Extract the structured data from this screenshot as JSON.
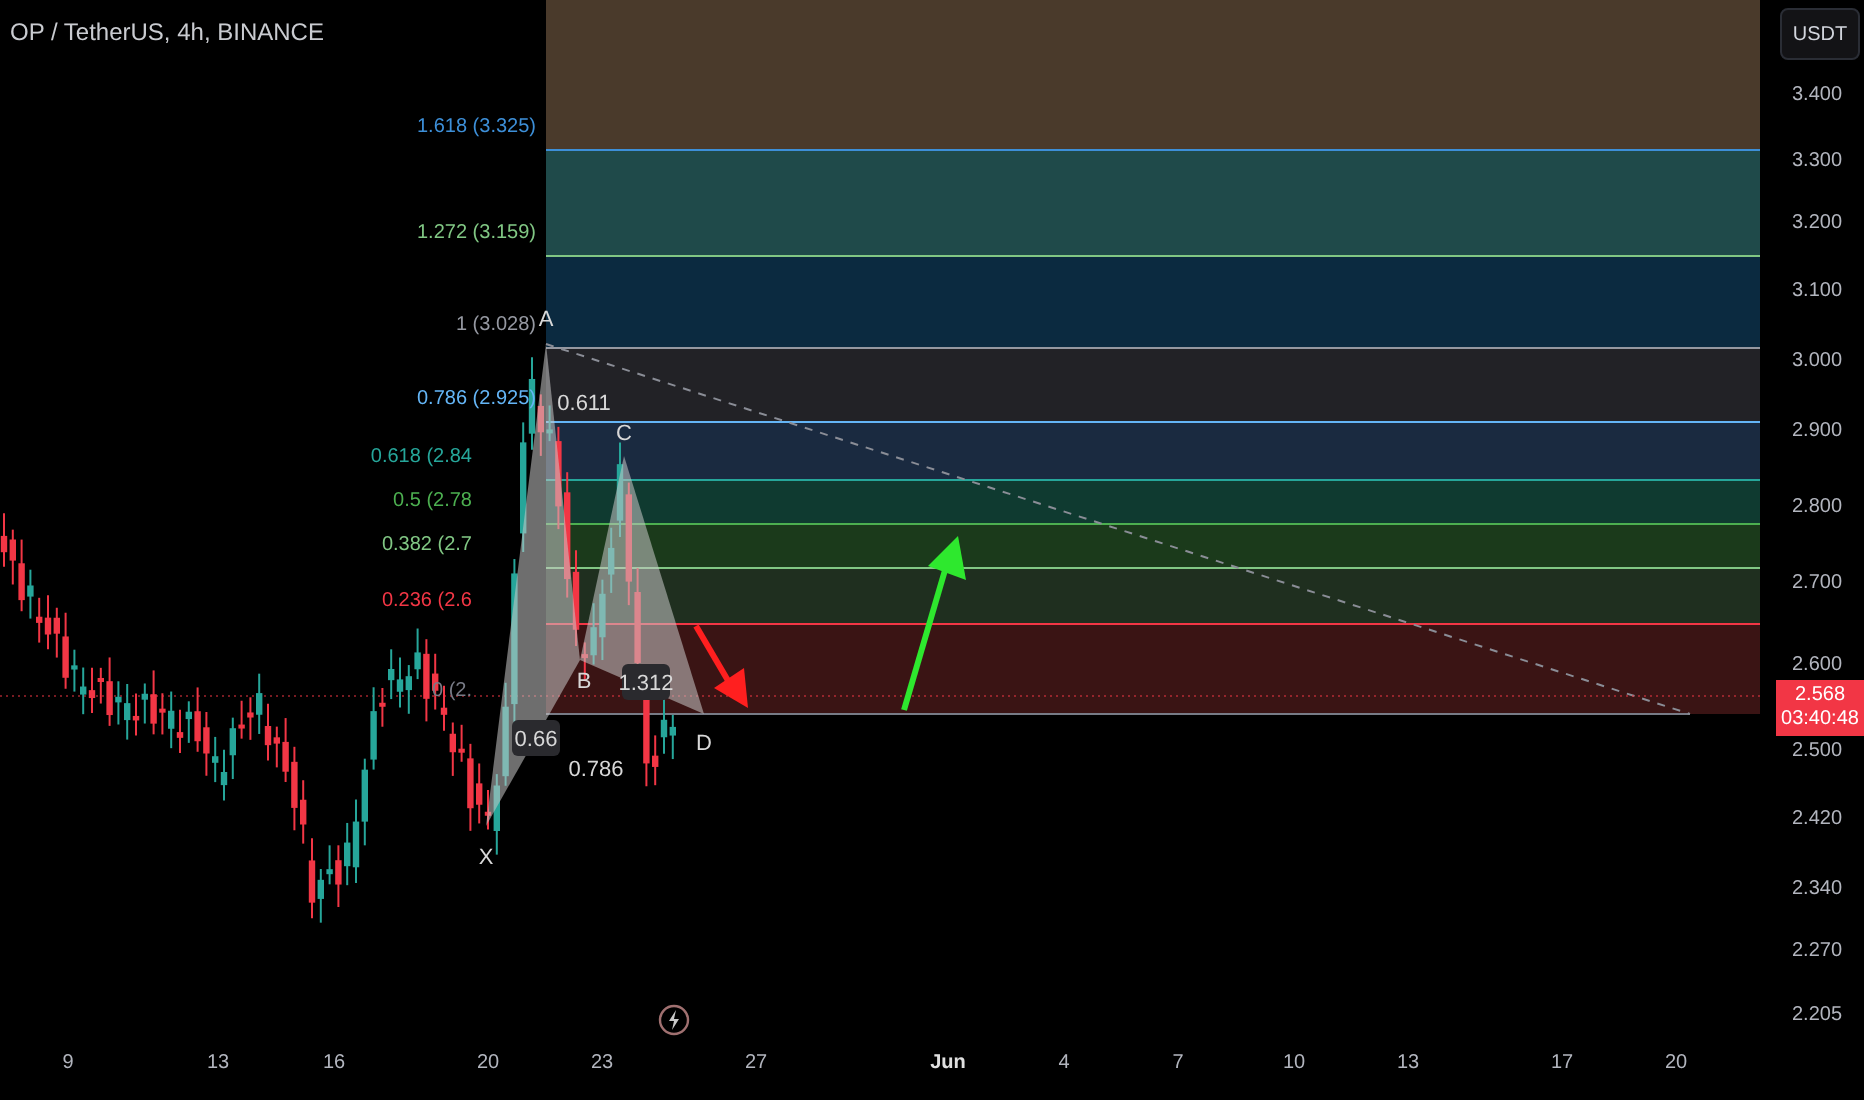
{
  "title": "OP / TetherUS, 4h, BINANCE",
  "currency_button": "USDT",
  "fib_levels": [
    {
      "label": "1.618 (3.325)",
      "color": "#3d8fd8"
    },
    {
      "label": "1.272 (3.159)",
      "color": "#81c784"
    },
    {
      "label": "1 (3.028)",
      "color": "#9598a1"
    },
    {
      "label": "0.786 (2.925)",
      "color": "#64b5f6"
    },
    {
      "label": "0.618 (2.84",
      "color": "#26a69a"
    },
    {
      "label": "0.5 (2.78",
      "color": "#4caf50"
    },
    {
      "label": "0.382 (2.7",
      "color": "#81c784"
    },
    {
      "label": "0.236 (2.6",
      "color": "#f23645"
    },
    {
      "label": "0 (2.",
      "color": "#787b86"
    }
  ],
  "pattern_points": [
    "X",
    "A",
    "B",
    "C",
    "D"
  ],
  "ratios": [
    "0.611",
    "0.66",
    "0.786",
    "1.312"
  ],
  "price_axis": [
    "3.400",
    "3.300",
    "3.200",
    "3.100",
    "3.000",
    "2.900",
    "2.800",
    "2.700",
    "2.600",
    "2.500",
    "2.420",
    "2.340",
    "2.270",
    "2.205"
  ],
  "last_price": {
    "price": "2.568",
    "countdown": "03:40:48"
  },
  "time_axis": [
    "9",
    "13",
    "16",
    "20",
    "23",
    "27",
    "Jun",
    "4",
    "7",
    "10",
    "13",
    "17",
    "20"
  ]
}
